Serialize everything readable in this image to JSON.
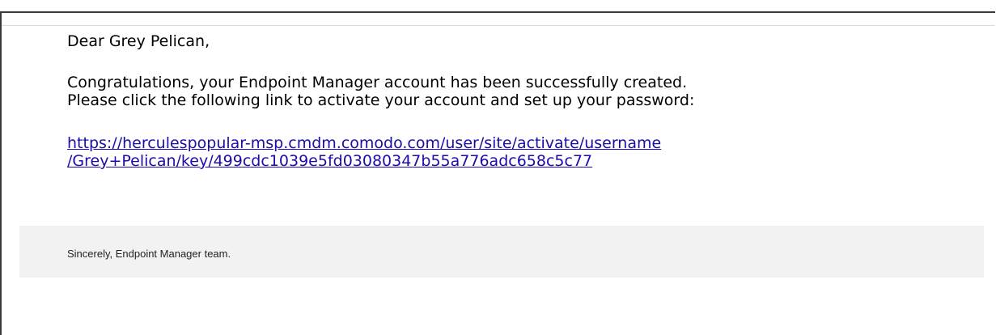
{
  "email": {
    "greeting": "Dear Grey Pelican,",
    "message_lines": [
      "Congratulations, your Endpoint Manager account has been successfully created.",
      "Please click the following link to activate your account and set up your password:"
    ],
    "activation_link": {
      "line1": "https://herculespopular-msp.cmdm.comodo.com/user/site/activate/username",
      "line2": "/Grey+Pelican/key/499cdc1039e5fd03080347b55a776adc658c5c77",
      "color": "#1a0dab"
    },
    "signature": "Sincerely, Endpoint Manager team."
  },
  "colors": {
    "footer_background": "#f2f2f2",
    "frame_border": "#3a3a3a"
  }
}
